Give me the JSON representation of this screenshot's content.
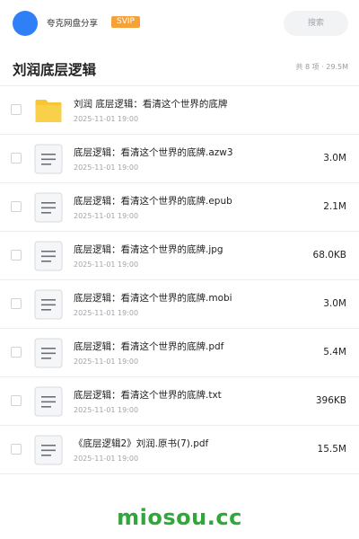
{
  "header": {
    "app_title": "夸克网盘分享",
    "badge": "SVIP",
    "search_placeholder": "搜索"
  },
  "folder": {
    "title": "刘润底层逻辑",
    "summary": "共 8 项 · 29.5M"
  },
  "colors": {
    "avatar": "#2f7ff7",
    "badge": "#f5a23a",
    "folder_icon": "#f7c630",
    "watermark": "#2fa83a"
  },
  "files": [
    {
      "name": "刘润 底层逻辑：看清这个世界的底牌",
      "date": "2025-11-01 19:00",
      "size": "",
      "icon": "folder-icon"
    },
    {
      "name": "底层逻辑：看清这个世界的底牌.azw3",
      "date": "2025-11-01 19:00",
      "size": "3.0M",
      "icon": "document-icon"
    },
    {
      "name": "底层逻辑：看清这个世界的底牌.epub",
      "date": "2025-11-01 19:00",
      "size": "2.1M",
      "icon": "document-icon"
    },
    {
      "name": "底层逻辑：看清这个世界的底牌.jpg",
      "date": "2025-11-01 19:00",
      "size": "68.0KB",
      "icon": "document-icon"
    },
    {
      "name": "底层逻辑：看清这个世界的底牌.mobi",
      "date": "2025-11-01 19:00",
      "size": "3.0M",
      "icon": "document-icon"
    },
    {
      "name": "底层逻辑：看清这个世界的底牌.pdf",
      "date": "2025-11-01 19:00",
      "size": "5.4M",
      "icon": "document-icon"
    },
    {
      "name": "底层逻辑：看清这个世界的底牌.txt",
      "date": "2025-11-01 19:00",
      "size": "396KB",
      "icon": "document-icon"
    },
    {
      "name": "《底层逻辑2》刘润.原书(7).pdf",
      "date": "2025-11-01 19:00",
      "size": "15.5M",
      "icon": "document-icon"
    }
  ],
  "watermark": "miosou.cc"
}
